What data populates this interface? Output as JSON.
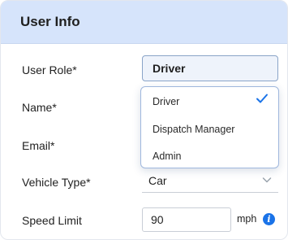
{
  "header": {
    "title": "User Info"
  },
  "fields": {
    "user_role": {
      "label": "User Role*",
      "value": "Driver"
    },
    "name": {
      "label": "Name*"
    },
    "email": {
      "label": "Email*"
    },
    "vehicle_type": {
      "label": "Vehicle Type*",
      "value": "Car"
    },
    "speed_limit": {
      "label": "Speed Limit",
      "value": "90",
      "unit": "mph"
    }
  },
  "role_dropdown": {
    "options": [
      "Driver",
      "Dispatch Manager",
      "Admin"
    ],
    "selected": "Driver"
  },
  "icons": {
    "check": "check-icon",
    "chevron": "chevron-down-icon",
    "info": "info-icon"
  },
  "colors": {
    "header_bg": "#d6e4fb",
    "accent": "#1a73e8"
  }
}
